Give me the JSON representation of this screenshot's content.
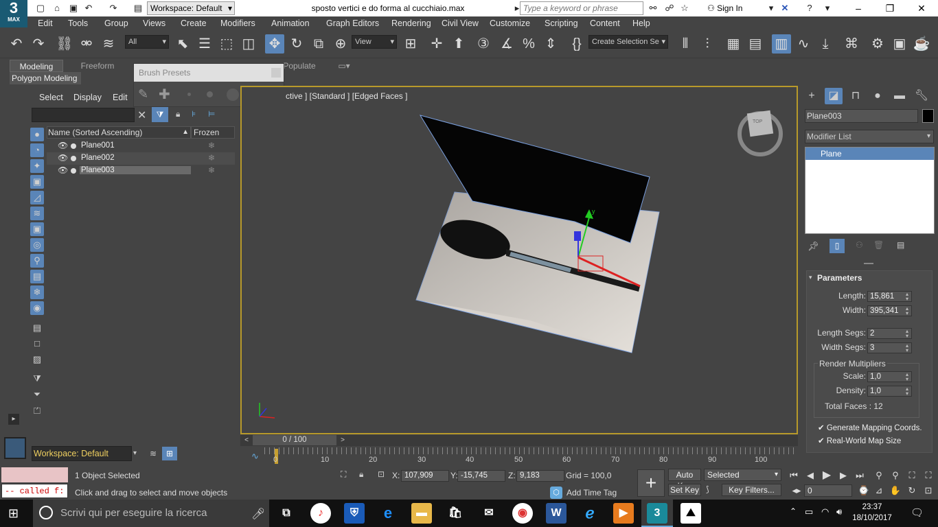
{
  "app": {
    "logo_main": "3",
    "logo_sub": "MAX",
    "workspace": "Workspace: Default",
    "file_title": "sposto vertici e do forma al cucchiaio.max",
    "search_placeholder": "Type a keyword or phrase",
    "signin": "Sign In"
  },
  "menu": [
    "Edit",
    "Tools",
    "Group",
    "Views",
    "Create",
    "Modifiers",
    "Animation",
    "Graph Editors",
    "Rendering",
    "Civil View",
    "Customize",
    "Scripting",
    "Content",
    "Help"
  ],
  "toolbar": {
    "filter": "All",
    "ref_coord": "View",
    "named_selection": "Create Selection Se"
  },
  "ribbon": {
    "tabs": [
      "Modeling",
      "Freeform",
      "Populate"
    ],
    "panel": "Polygon Modeling"
  },
  "brush_presets": {
    "title": "Brush Presets"
  },
  "scene_explorer": {
    "menu": [
      "Select",
      "Display",
      "Edit"
    ],
    "col_name": "Name (Sorted Ascending)",
    "col_frozen": "Frozen",
    "rows": [
      "Plane001",
      "Plane002",
      "Plane003"
    ],
    "workspace": "Workspace: Default"
  },
  "viewport": {
    "label": "ctive ] [Standard ] [Edged Faces ]"
  },
  "timeline": {
    "frame": "0 / 100",
    "ticks": [
      "0",
      "10",
      "20",
      "30",
      "40",
      "50",
      "60",
      "70",
      "80",
      "90",
      "100"
    ]
  },
  "command_panel": {
    "object_name": "Plane003",
    "modifier_list": "Modifier List",
    "stack_item": "Plane",
    "rollout": "Parameters",
    "length_label": "Length:",
    "length": "15,861",
    "width_label": "Width:",
    "width": "395,341",
    "length_segs_label": "Length Segs:",
    "length_segs": "2",
    "width_segs_label": "Width Segs:",
    "width_segs": "3",
    "render_mult": "Render Multipliers",
    "scale_label": "Scale:",
    "scale": "1,0",
    "density_label": "Density:",
    "density": "1,0",
    "total_faces": "Total Faces : 12",
    "gen_mapping": "Generate Mapping Coords.",
    "real_world": "Real-World Map Size"
  },
  "status": {
    "maxscript": "-- called f:",
    "selected": "1 Object Selected",
    "hint": "Click and drag to select and move objects",
    "x_label": "X:",
    "x": "107,909",
    "y_label": "Y:",
    "y": "-15,745",
    "z_label": "Z:",
    "z": "9,183",
    "grid": "Grid = 100,0",
    "add_time_tag": "Add Time Tag",
    "auto_key": "Auto Key",
    "set_key": "Set Key",
    "selected_dd": "Selected",
    "key_filters": "Key Filters...",
    "frame_field": "0"
  },
  "taskbar": {
    "search": "Scrivi qui per eseguire la ricerca",
    "time": "23:37",
    "date": "18/10/2017"
  }
}
